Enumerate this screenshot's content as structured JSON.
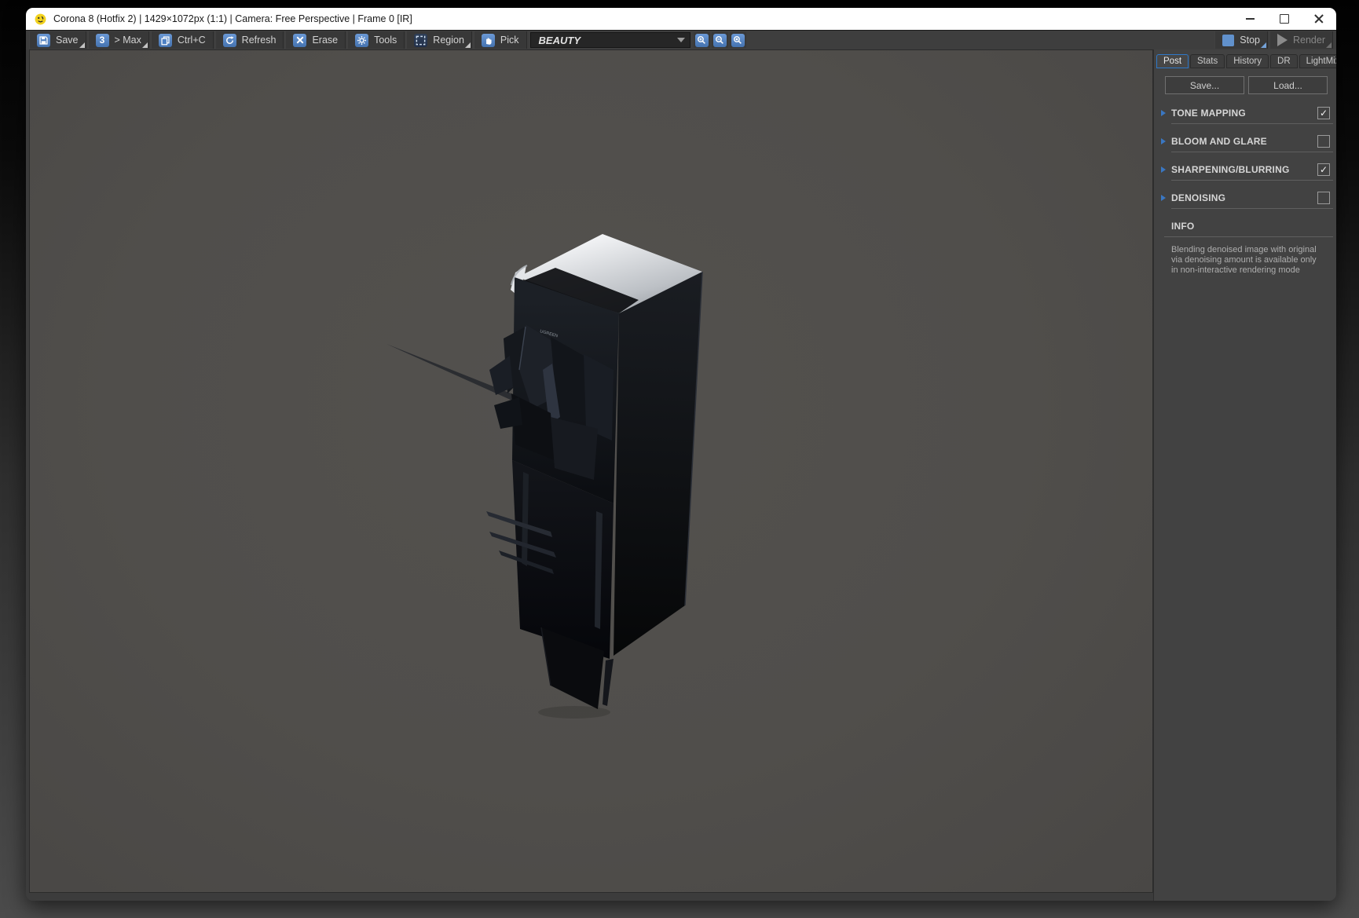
{
  "window": {
    "title": "Corona 8 (Hotfix 2) | 1429×1072px (1:1) | Camera: Free Perspective | Frame 0 [IR]"
  },
  "toolbar": {
    "save": "Save",
    "slot": "3",
    "max": "> Max",
    "copy": "Ctrl+C",
    "refresh": "Refresh",
    "erase": "Erase",
    "tools": "Tools",
    "region": "Region",
    "pick": "Pick",
    "channel": "BEAUTY",
    "stop": "Stop",
    "render": "Render"
  },
  "panel": {
    "tabs": [
      {
        "label": "Post"
      },
      {
        "label": "Stats"
      },
      {
        "label": "History"
      },
      {
        "label": "DR"
      },
      {
        "label": "LightMix"
      }
    ],
    "save_button": "Save...",
    "load_button": "Load...",
    "sections": [
      {
        "label": "TONE MAPPING",
        "checked": true,
        "check": "✓"
      },
      {
        "label": "BLOOM AND GLARE",
        "checked": false,
        "check": ""
      },
      {
        "label": "SHARPENING/BLURRING",
        "checked": true,
        "check": "✓"
      },
      {
        "label": "DENOISING",
        "checked": false,
        "check": ""
      }
    ],
    "info_label": "INFO",
    "info_text": "Blending denoised image with original via denoising amount is available only in non-interactive rendering mode"
  },
  "viewport": {
    "object_logo": "UGREEN"
  },
  "colors": {
    "accent_blue": "#4d80c4",
    "tab_active_border": "#2e78c8",
    "titlebar": "#ffffff",
    "viewport_bg": "#504e4b",
    "panel_bg": "#424242"
  }
}
